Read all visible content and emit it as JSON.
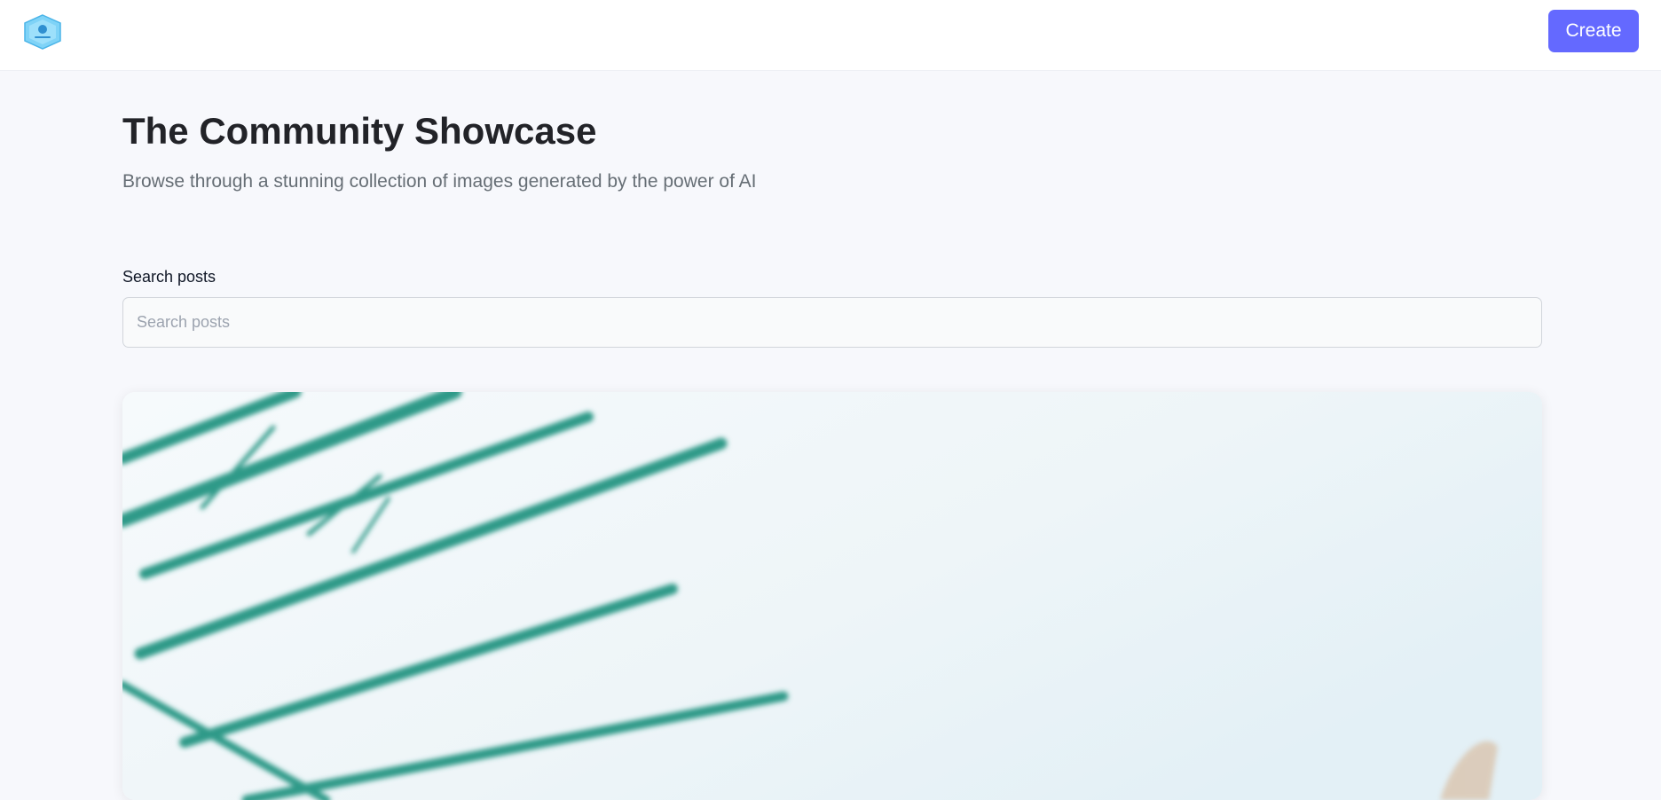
{
  "header": {
    "logo_icon": "hexagon-logo-icon",
    "create_label": "Create",
    "accent_color": "#6469ff"
  },
  "hero": {
    "title": "The Community Showcase",
    "subtitle": "Browse through a stunning collection of images generated by the power of AI"
  },
  "search": {
    "label": "Search posts",
    "placeholder": "Search posts",
    "value": ""
  },
  "posts": [
    {
      "image_icon": "palm-leaves-sky-image"
    }
  ]
}
